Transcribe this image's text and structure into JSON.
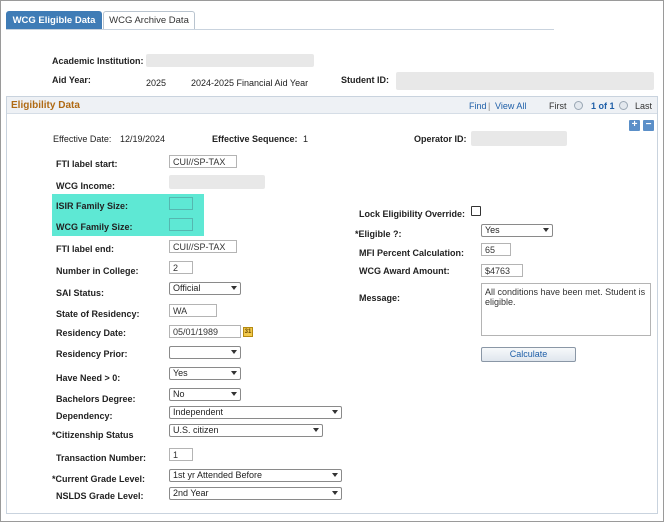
{
  "tabs": [
    {
      "label": "WCG Eligible Data",
      "active": true
    },
    {
      "label": "WCG Archive Data",
      "active": false
    }
  ],
  "header": {
    "academic_institution_label": "Academic Institution:",
    "aid_year_label": "Aid Year:",
    "aid_year_value": "2025",
    "aid_year_desc": "2024-2025 Financial Aid Year",
    "student_id_label": "Student ID:"
  },
  "section": {
    "title": "Eligibility Data",
    "find": "Find",
    "view_all": "View All",
    "first": "First",
    "page_info": "1 of 1",
    "last": "Last"
  },
  "effective": {
    "date_label": "Effective Date:",
    "date_value": "12/19/2024",
    "seq_label": "Effective Sequence:",
    "seq_value": "1",
    "operator_label": "Operator ID:"
  },
  "left_fields": {
    "fti_label_start_label": "FTI label start:",
    "fti_label_start_value": "CUI//SP-TAX",
    "wcg_income_label": "WCG Income:",
    "isir_family_size_label": "ISIR Family Size:",
    "wcg_family_size_label": "WCG Family Size:",
    "fti_label_end_label": "FTI label end:",
    "fti_label_end_value": "CUI//SP-TAX",
    "number_in_college_label": "Number in College:",
    "number_in_college_value": "2",
    "sai_status_label": "SAI Status:",
    "sai_status_value": "Official",
    "state_of_residency_label": "State of Residency:",
    "state_of_residency_value": "WA",
    "residency_date_label": "Residency Date:",
    "residency_date_value": "05/01/1989",
    "residency_prior_label": "Residency Prior:",
    "residency_prior_value": "",
    "have_need_label": "Have Need > 0:",
    "have_need_value": "Yes",
    "bachelors_degree_label": "Bachelors Degree:",
    "bachelors_degree_value": "No",
    "dependency_label": "Dependency:",
    "dependency_value": "Independent",
    "citizenship_label": "*Citizenship Status",
    "citizenship_value": "U.S. citizen",
    "transaction_number_label": "Transaction Number:",
    "transaction_number_value": "1",
    "current_grade_label": "*Current Grade Level:",
    "current_grade_value": "1st yr Attended Before",
    "nslds_grade_label": "NSLDS Grade Level:",
    "nslds_grade_value": "2nd Year"
  },
  "right_fields": {
    "lock_override_label": "Lock Eligibility Override:",
    "eligible_label": "*Eligible ?:",
    "eligible_value": "Yes",
    "mfi_label": "MFI Percent Calculation:",
    "mfi_value": "65",
    "wcg_award_label": "WCG Award Amount:",
    "wcg_award_value": "$4763",
    "message_label": "Message:",
    "message_value": "All conditions have been met.  Student is eligible.",
    "calculate_label": "Calculate"
  },
  "colors": {
    "highlight": "#5ee8d4",
    "tab_active": "#3f7cb6",
    "section_title": "#b06a14",
    "link": "#1f5fa8"
  }
}
